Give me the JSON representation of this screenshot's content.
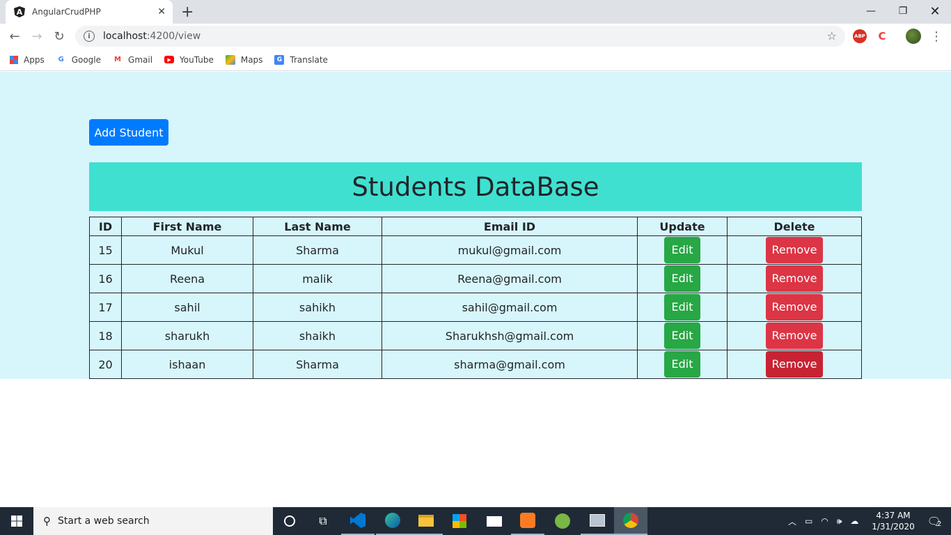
{
  "browser": {
    "tab_title": "AngularCrudPHP",
    "tab_favicon": "A",
    "url_host": "localhost",
    "url_path": ":4200/view",
    "bookmarks": [
      {
        "label": "Apps",
        "icon": "apps-grid-icon"
      },
      {
        "label": "Google",
        "icon": "google-icon"
      },
      {
        "label": "Gmail",
        "icon": "gmail-icon"
      },
      {
        "label": "YouTube",
        "icon": "youtube-icon"
      },
      {
        "label": "Maps",
        "icon": "maps-icon"
      },
      {
        "label": "Translate",
        "icon": "translate-icon"
      }
    ],
    "extensions": [
      "ABP",
      "C"
    ]
  },
  "page": {
    "add_button": "Add Student",
    "heading": "Students DataBase",
    "columns": [
      "ID",
      "First Name",
      "Last Name",
      "Email ID",
      "Update",
      "Delete"
    ],
    "edit_label": "Edit",
    "remove_label": "Remove",
    "rows": [
      {
        "id": "15",
        "first": "Mukul",
        "last": "Sharma",
        "email": "mukul@gmail.com"
      },
      {
        "id": "16",
        "first": "Reena",
        "last": "malik",
        "email": "Reena@gmail.com"
      },
      {
        "id": "17",
        "first": "sahil",
        "last": "sahikh",
        "email": "sahil@gmail.com"
      },
      {
        "id": "18",
        "first": "sharukh",
        "last": "shaikh",
        "email": "Sharukhsh@gmail.com"
      },
      {
        "id": "20",
        "first": "ishaan",
        "last": "Sharma",
        "email": "sharma@gmail.com"
      }
    ]
  },
  "taskbar": {
    "search_placeholder": "Start a web search",
    "time": "4:37 AM",
    "date": "1/31/2020",
    "notification_count": "2"
  },
  "colors": {
    "page_bg": "#d7f6fb",
    "header_bg": "#40e0d0",
    "primary": "#007bff",
    "success": "#28a745",
    "danger": "#dc3545"
  }
}
